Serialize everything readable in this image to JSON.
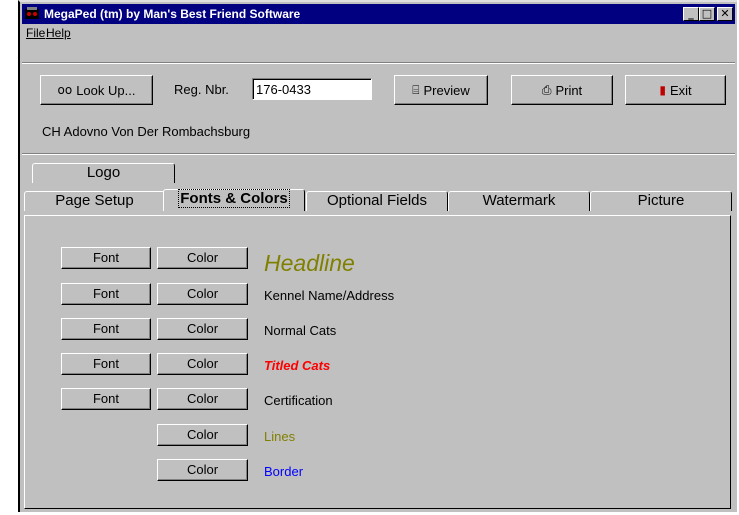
{
  "window": {
    "title": "MegaPed (tm) by Man's Best Friend Software",
    "controls": {
      "minimize": "_",
      "maximize": "□",
      "close": "✕"
    }
  },
  "menu": {
    "file": "File",
    "help": "Help"
  },
  "toolbar": {
    "lookup_label": "Look Up...",
    "reg_label": "Reg. Nbr.",
    "reg_value": "176-0433",
    "preview_label": "Preview",
    "print_label": "Print",
    "exit_label": "Exit"
  },
  "subject_name": "CH Adovno Von Der Rombachsburg",
  "tabs": {
    "row_top": [
      "Logo"
    ],
    "row_bottom": [
      "Page Setup",
      "Fonts & Colors",
      "Optional Fields",
      "Watermark",
      "Picture"
    ],
    "active": "Fonts & Colors"
  },
  "fonts_colors": {
    "font_label": "Font",
    "color_label": "Color",
    "items": [
      {
        "label": "Headline",
        "has_font": true,
        "color": "#808000"
      },
      {
        "label": "Kennel Name/Address",
        "has_font": true,
        "color": "#000000"
      },
      {
        "label": "Normal Cats",
        "has_font": true,
        "color": "#000000"
      },
      {
        "label": "Titled Cats",
        "has_font": true,
        "color": "#ff0000"
      },
      {
        "label": "Certification",
        "has_font": true,
        "color": "#000000"
      },
      {
        "label": "Lines",
        "has_font": false,
        "color": "#808000"
      },
      {
        "label": "Border",
        "has_font": false,
        "color": "#0000ff"
      }
    ]
  },
  "colors": {
    "titlebar": "#000080",
    "face": "#c0c0c0"
  }
}
